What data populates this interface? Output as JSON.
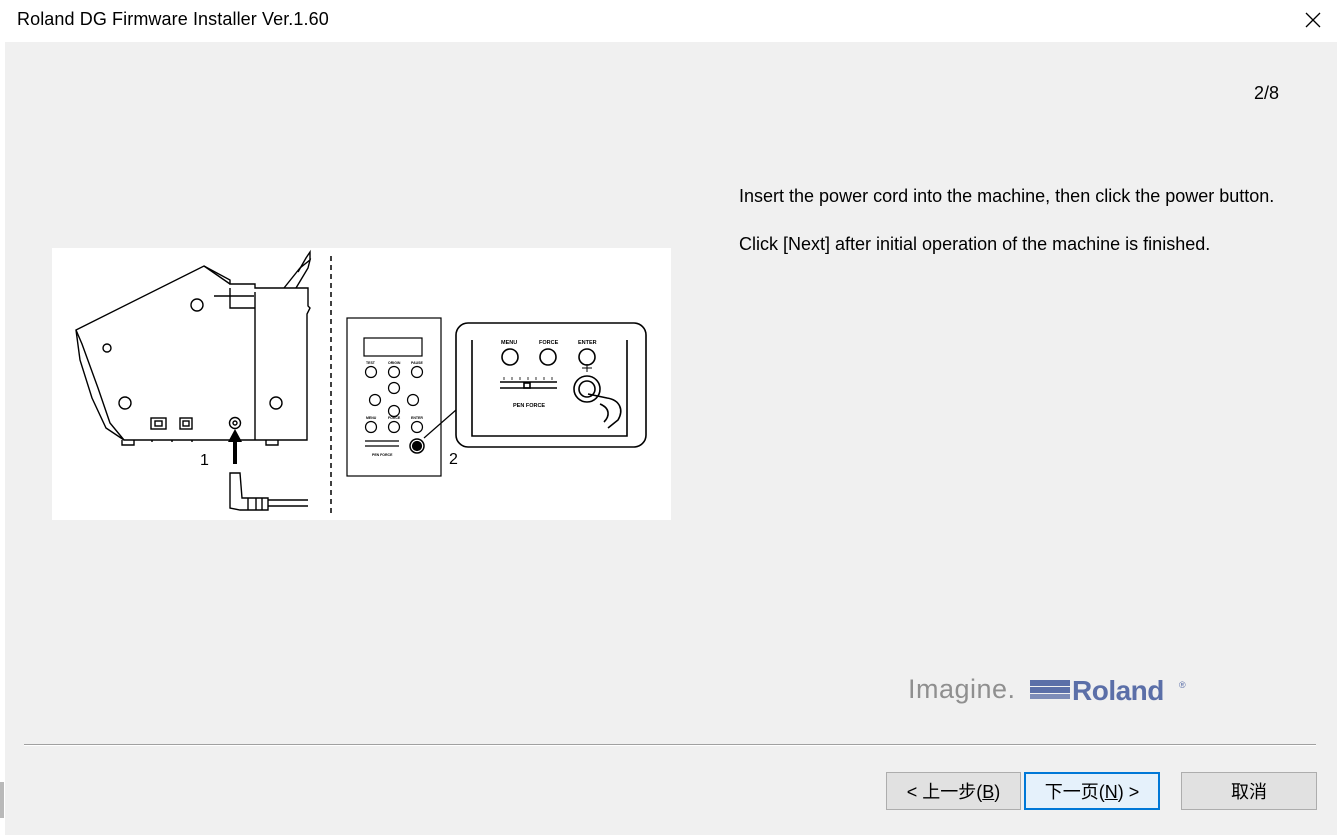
{
  "window": {
    "title": "Roland DG Firmware Installer Ver.1.60"
  },
  "wizard": {
    "page_counter": "2/8",
    "instruction_1": "Insert the power cord into the machine, then click the power button.",
    "instruction_2": "Click [Next] after initial operation of the machine is finished."
  },
  "illustration": {
    "step_1_label": "1",
    "step_2_label": "2",
    "panel_buttons": [
      "TEST",
      "ORIGIN",
      "PAUSE",
      "MENU",
      "FORCE",
      "ENTER"
    ],
    "panel_slider_label": "PEN FORCE",
    "zoom_buttons": [
      "MENU",
      "FORCE",
      "ENTER"
    ],
    "zoom_slider_label": "PEN FORCE"
  },
  "brand": {
    "tagline": "Imagine.",
    "logo_text": "Roland",
    "registered_mark": "®"
  },
  "buttons": {
    "back_prefix": "< 上一步(",
    "back_key": "B",
    "back_suffix": ")",
    "next_prefix": "下一页(",
    "next_key": "N",
    "next_suffix": ") >",
    "cancel": "取消"
  },
  "colors": {
    "window_bg": "#f0f0f0",
    "focus_border": "#0078d7",
    "roland_blue": "#5b6fa8"
  }
}
